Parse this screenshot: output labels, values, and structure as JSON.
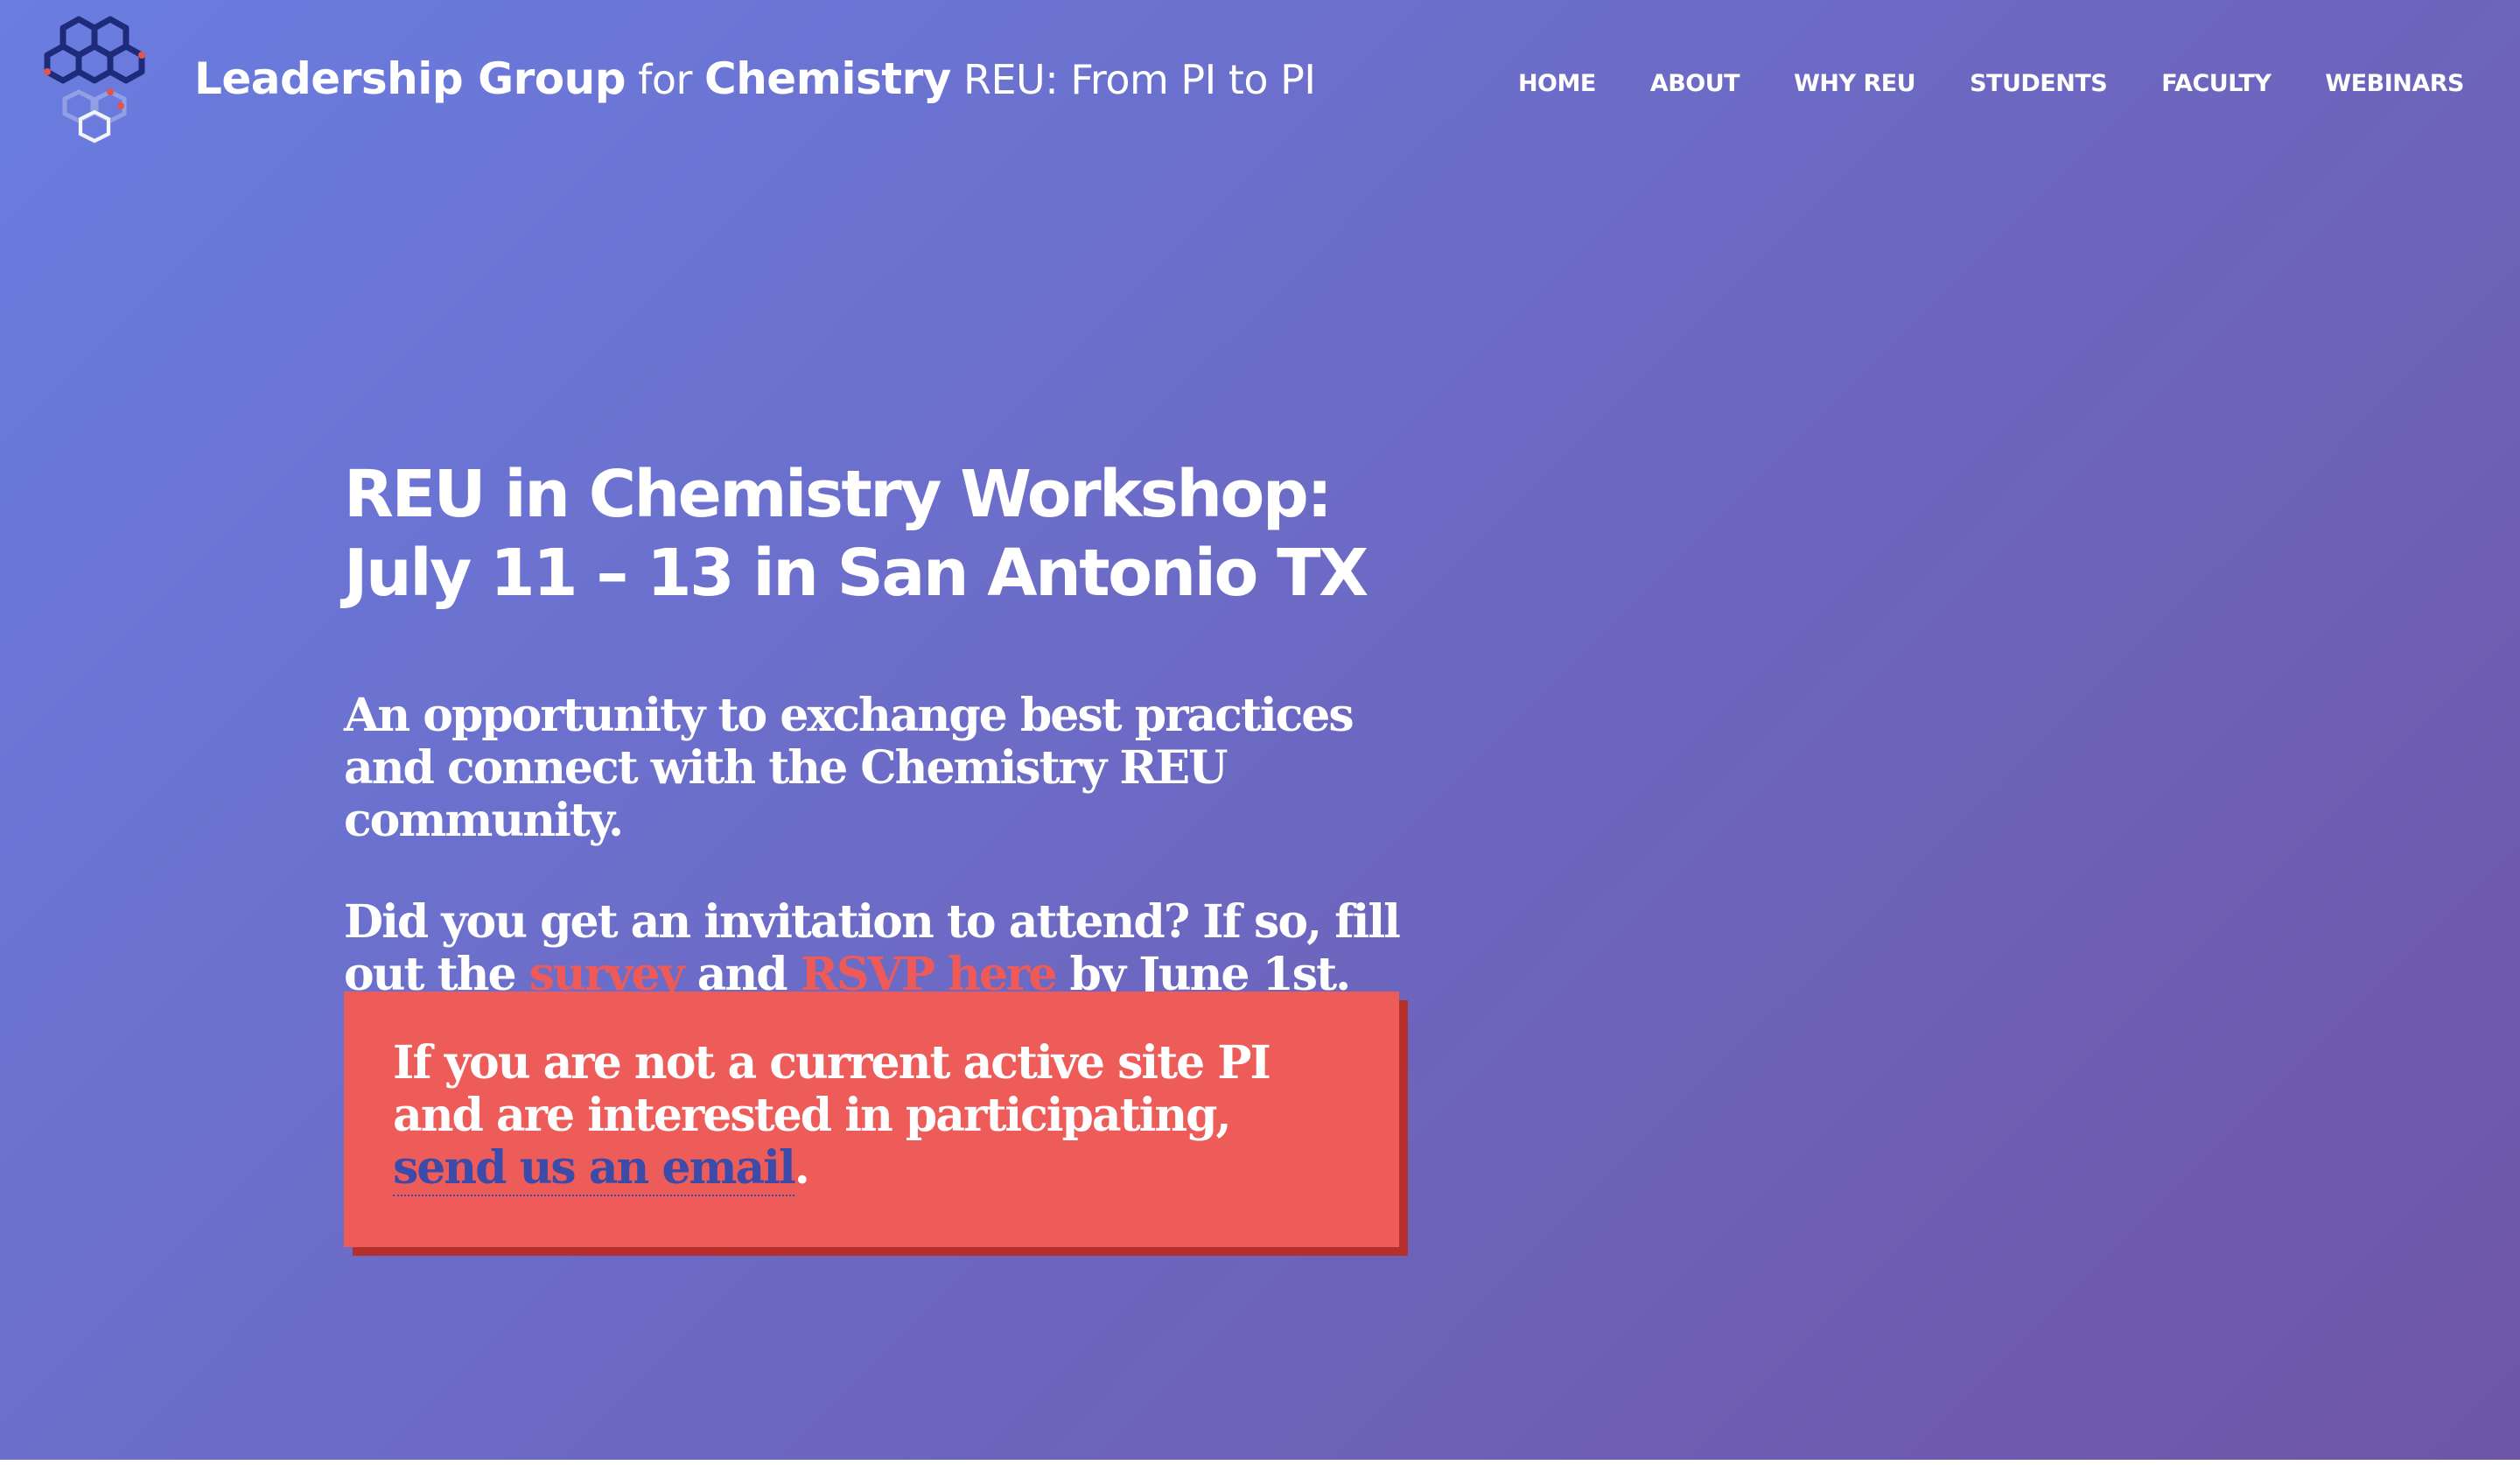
{
  "header": {
    "title_part1": "Leadership Group",
    "title_part2": " for ",
    "title_part3": "Chemistry",
    "title_part4": " REU: From PI to PI",
    "logo_icon": "molecule-logo-icon"
  },
  "nav": {
    "items": [
      {
        "label": "HOME"
      },
      {
        "label": "ABOUT"
      },
      {
        "label": "WHY REU"
      },
      {
        "label": "STUDENTS"
      },
      {
        "label": "FACULTY"
      },
      {
        "label": "WEBINARS"
      }
    ]
  },
  "main": {
    "headline": "REU in Chemistry Workshop: July 11 – 13 in San Antonio TX",
    "lede": "An opportunity to exchange best practices and connect with the Chemistry REU community.",
    "invite_text1": "Did you get an invitation to attend? If so, fill out the ",
    "survey_link": "survey",
    "invite_text2": " and ",
    "rsvp_link": "RSVP here",
    "invite_text3": " by June 1st."
  },
  "callout": {
    "text": "If you are not a current active site PI and are interested in participating, ",
    "email_link": "send us an email",
    "end": "."
  },
  "colors": {
    "link_red": "#ee5a58",
    "callout_bg": "#ee5c5a",
    "callout_shadow": "#b5302d",
    "callout_link": "#3c4aa8",
    "bg_start": "#6a7de0",
    "bg_end": "#6e55a6"
  }
}
